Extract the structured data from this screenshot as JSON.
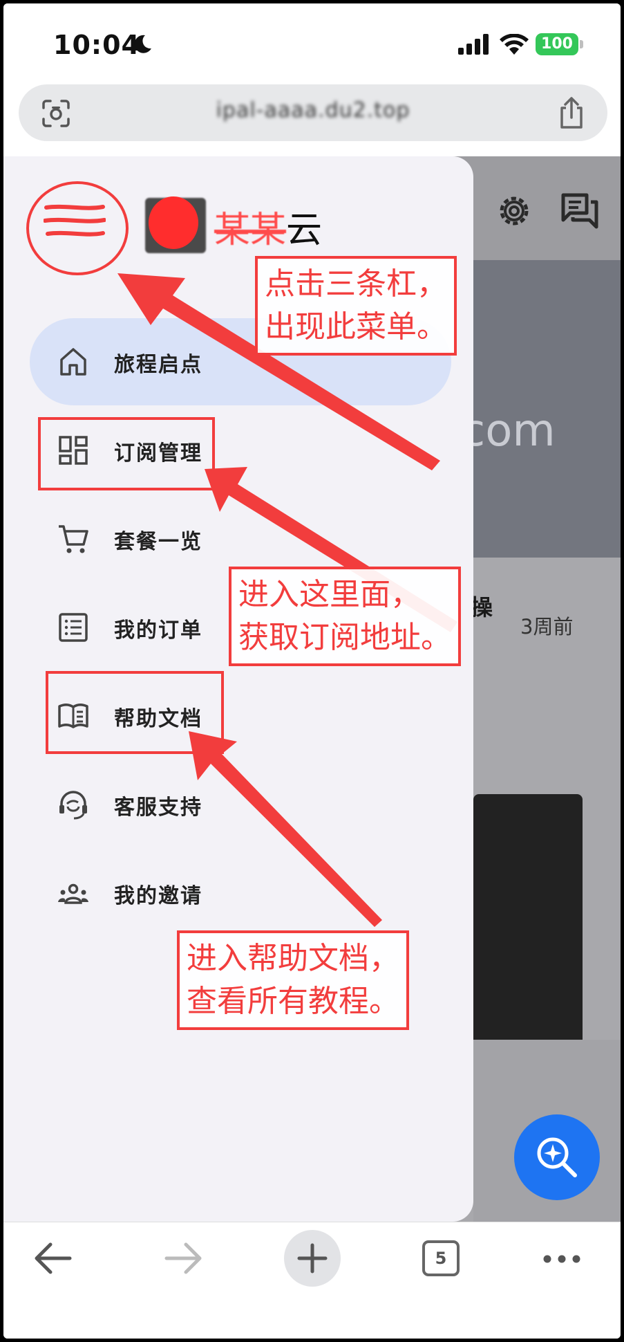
{
  "status_bar": {
    "time": "10:04",
    "battery": "100"
  },
  "url_bar": {
    "url_first_char": "i",
    "url_blurred": "pal-aaaa.du2.top"
  },
  "drawer": {
    "brand_masked": "某某",
    "brand_suffix": "云",
    "items": [
      {
        "label": "旅程启点",
        "icon": "home-icon",
        "active": true
      },
      {
        "label": "订阅管理",
        "icon": "grid-icon",
        "active": false
      },
      {
        "label": "套餐一览",
        "icon": "cart-icon",
        "active": false
      },
      {
        "label": "我的订单",
        "icon": "list-icon",
        "active": false
      },
      {
        "label": "帮助文档",
        "icon": "book-icon",
        "active": false
      },
      {
        "label": "客服支持",
        "icon": "headset-icon",
        "active": false
      },
      {
        "label": "我的邀请",
        "icon": "people-icon",
        "active": false
      }
    ]
  },
  "background_page": {
    "banner_text": "com",
    "item_title_fragment": "操",
    "item_time": "3周前"
  },
  "toolbar": {
    "tab_count": "5"
  },
  "annotations": {
    "callout_menu": [
      "点击三条杠，",
      "出现此菜单。"
    ],
    "callout_subscribe": [
      "进入这里面，",
      "获取订阅地址。"
    ],
    "callout_help": [
      "进入帮助文档，",
      "查看所有教程。"
    ]
  },
  "colors": {
    "annotation_red": "#f23d3d",
    "active_item_bg": "#d9e2f8",
    "fab_blue": "#1e74f2",
    "battery_green": "#34c759"
  }
}
